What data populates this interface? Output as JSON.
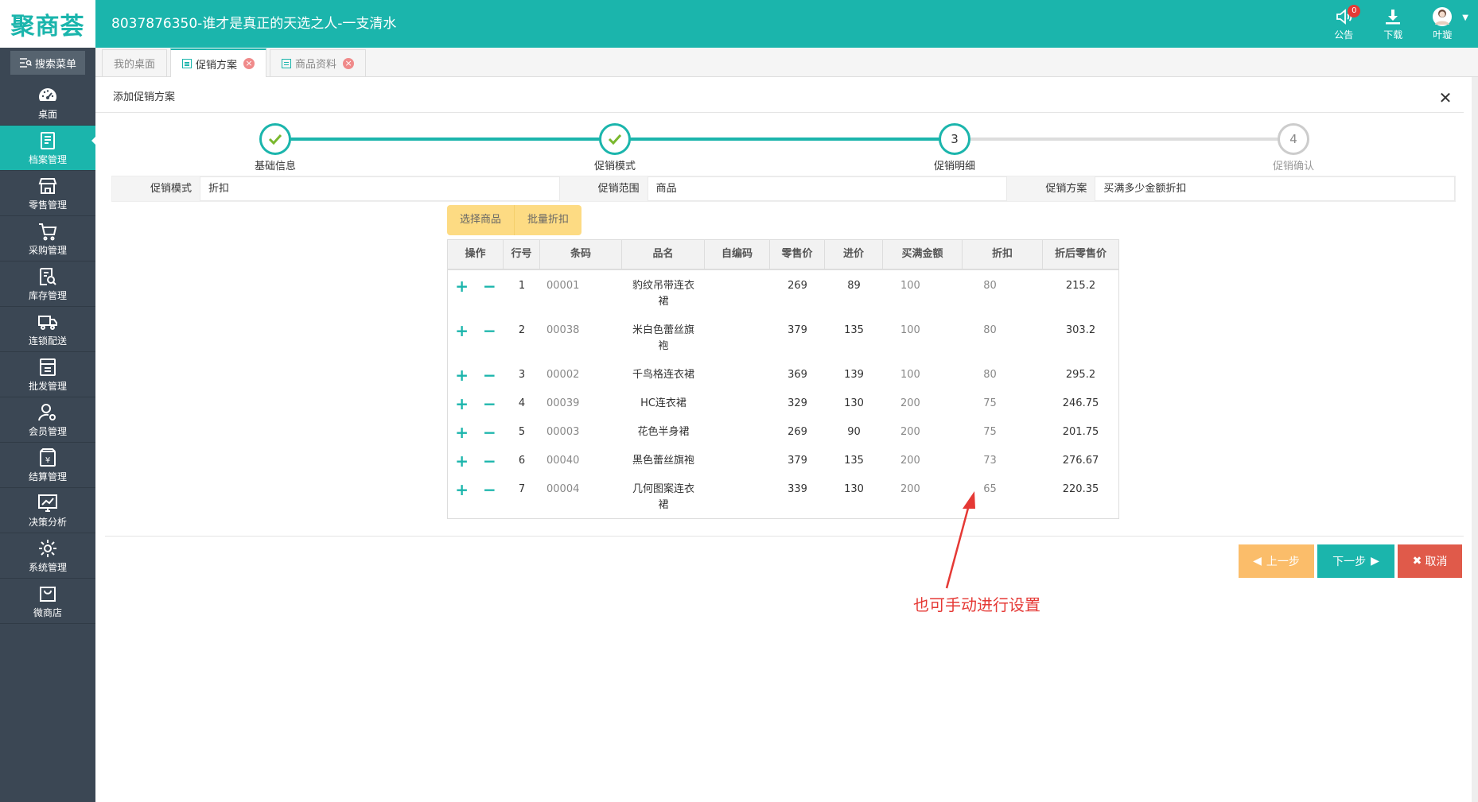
{
  "header": {
    "logo": "聚商荟",
    "title": "8037876350-谁才是真正的天选之人-一支清水",
    "actions": [
      {
        "label": "公告",
        "icon": "speaker-icon",
        "badge": "0"
      },
      {
        "label": "下载",
        "icon": "download-icon"
      },
      {
        "label": "叶璇",
        "icon": "avatar"
      }
    ]
  },
  "sidebar": {
    "search_label": "搜索菜单",
    "items": [
      {
        "label": "桌面",
        "icon": "dashboard-icon"
      },
      {
        "label": "档案管理",
        "icon": "archive-icon",
        "active": true
      },
      {
        "label": "零售管理",
        "icon": "store-icon"
      },
      {
        "label": "采购管理",
        "icon": "cart-icon"
      },
      {
        "label": "库存管理",
        "icon": "inventory-search-icon"
      },
      {
        "label": "连锁配送",
        "icon": "truck-icon"
      },
      {
        "label": "批发管理",
        "icon": "wholesale-icon"
      },
      {
        "label": "会员管理",
        "icon": "member-icon"
      },
      {
        "label": "结算管理",
        "icon": "settlement-icon"
      },
      {
        "label": "决策分析",
        "icon": "chart-icon"
      },
      {
        "label": "系统管理",
        "icon": "gear-icon"
      },
      {
        "label": "微商店",
        "icon": "shop-bag-icon"
      }
    ]
  },
  "tabs": [
    {
      "label": "我的桌面",
      "active": false,
      "closable": false
    },
    {
      "label": "促销方案",
      "active": true,
      "closable": true
    },
    {
      "label": "商品资料",
      "active": false,
      "closable": true
    }
  ],
  "panel": {
    "title": "添加促销方案",
    "close_icon": "close-icon"
  },
  "steps": [
    {
      "label": "基础信息",
      "state": "done",
      "number": "1"
    },
    {
      "label": "促销模式",
      "state": "done",
      "number": "2"
    },
    {
      "label": "促销明细",
      "state": "current",
      "number": "3"
    },
    {
      "label": "促销确认",
      "state": "todo",
      "number": "4"
    }
  ],
  "info": {
    "mode_label": "促销模式",
    "mode_value": "折扣",
    "scope_label": "促销范围",
    "scope_value": "商品",
    "plan_label": "促销方案",
    "plan_value": "买满多少金额折扣"
  },
  "buttons": {
    "select_goods": "选择商品",
    "batch_discount": "批量折扣",
    "prev": "上一步",
    "next": "下一步",
    "cancel": "取消"
  },
  "table": {
    "columns": [
      "操作",
      "行号",
      "条码",
      "品名",
      "自编码",
      "零售价",
      "进价",
      "买满金额",
      "折扣",
      "折后零售价"
    ],
    "rows": [
      {
        "no": "1",
        "barcode": "00001",
        "name": "豹纹吊带连衣裙",
        "code": "",
        "retail": "269",
        "cost": "89",
        "threshold": "100",
        "discount": "80",
        "final": "215.2"
      },
      {
        "no": "2",
        "barcode": "00038",
        "name": "米白色蕾丝旗袍",
        "code": "",
        "retail": "379",
        "cost": "135",
        "threshold": "100",
        "discount": "80",
        "final": "303.2"
      },
      {
        "no": "3",
        "barcode": "00002",
        "name": "千鸟格连衣裙",
        "code": "",
        "retail": "369",
        "cost": "139",
        "threshold": "100",
        "discount": "80",
        "final": "295.2"
      },
      {
        "no": "4",
        "barcode": "00039",
        "name": "HC连衣裙",
        "code": "",
        "retail": "329",
        "cost": "130",
        "threshold": "200",
        "discount": "75",
        "final": "246.75"
      },
      {
        "no": "5",
        "barcode": "00003",
        "name": "花色半身裙",
        "code": "",
        "retail": "269",
        "cost": "90",
        "threshold": "200",
        "discount": "75",
        "final": "201.75"
      },
      {
        "no": "6",
        "barcode": "00040",
        "name": "黑色蕾丝旗袍",
        "code": "",
        "retail": "379",
        "cost": "135",
        "threshold": "200",
        "discount": "73",
        "final": "276.67"
      },
      {
        "no": "7",
        "barcode": "00004",
        "name": "几何图案连衣裙",
        "code": "",
        "retail": "339",
        "cost": "130",
        "threshold": "200",
        "discount": "65",
        "final": "220.35"
      }
    ]
  },
  "annotation": {
    "text": "也可手动进行设置",
    "color": "#e53935"
  },
  "colors": {
    "accent": "#1bb5ac",
    "sidebar": "#3b4754",
    "prev_button": "#fbbd6a",
    "cancel_button": "#e05a4a",
    "tool_button": "#fddb83"
  }
}
